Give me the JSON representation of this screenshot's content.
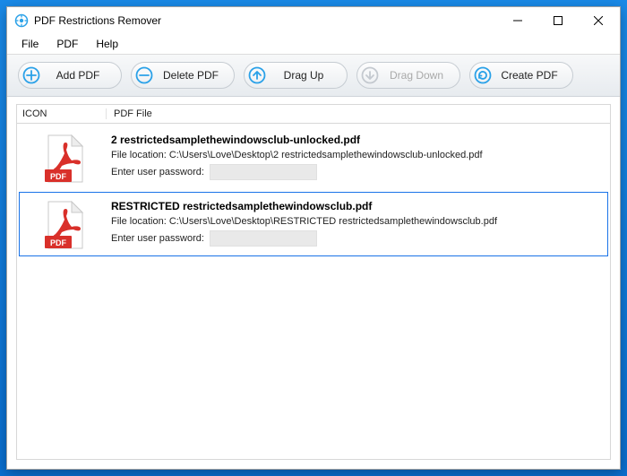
{
  "window": {
    "title": "PDF Restrictions Remover"
  },
  "menu": {
    "file": "File",
    "pdf": "PDF",
    "help": "Help"
  },
  "toolbar": {
    "add": "Add PDF",
    "delete": "Delete PDF",
    "drag_up": "Drag Up",
    "drag_down": "Drag Down",
    "create": "Create PDF"
  },
  "list": {
    "header_icon": "ICON",
    "header_file": "PDF File",
    "file_location_prefix": "File location: ",
    "password_label": "Enter user password:"
  },
  "rows": [
    {
      "name": "2 restrictedsamplethewindowsclub-unlocked.pdf",
      "location": "C:\\Users\\Love\\Desktop\\2 restrictedsamplethewindowsclub-unlocked.pdf",
      "password_value": "",
      "selected": false
    },
    {
      "name": "RESTRICTED restrictedsamplethewindowsclub.pdf",
      "location": "C:\\Users\\Love\\Desktop\\RESTRICTED restrictedsamplethewindowsclub.pdf",
      "password_value": "",
      "selected": true
    }
  ],
  "colors": {
    "accent": "#1a73e8",
    "ring": "#2aa1e8"
  }
}
